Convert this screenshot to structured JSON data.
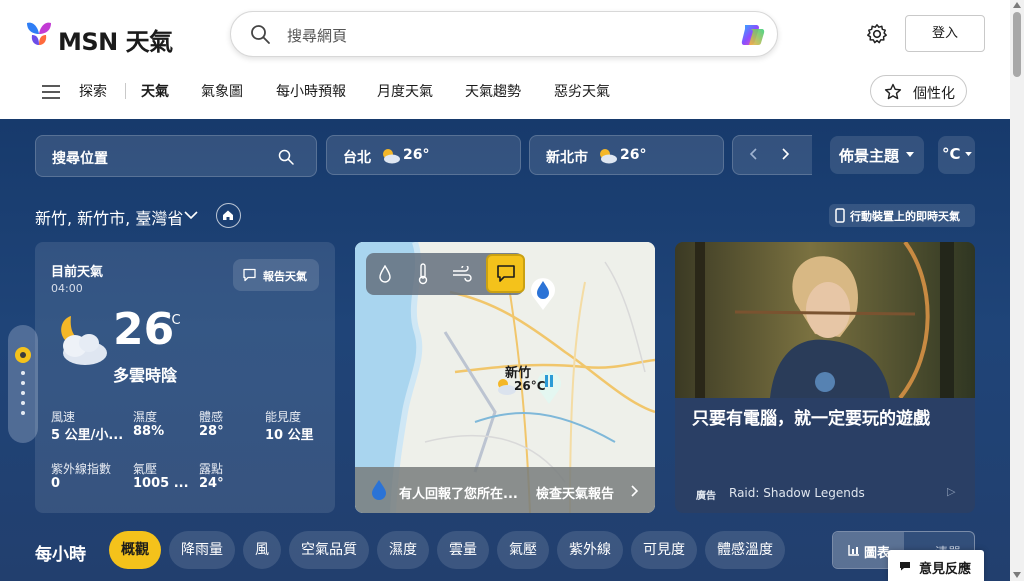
{
  "header": {
    "logo_text": "MSN 天氣",
    "search_placeholder": "搜尋網頁",
    "signin_label": "登入"
  },
  "nav": {
    "items": [
      {
        "label": "探索"
      },
      {
        "label": "天氣",
        "active": true
      },
      {
        "label": "氣象圖"
      },
      {
        "label": "每小時預報"
      },
      {
        "label": "月度天氣"
      },
      {
        "label": "天氣趨勢"
      },
      {
        "label": "惡劣天氣"
      }
    ],
    "personalize_label": "個性化"
  },
  "weather_bar": {
    "location_search_placeholder": "搜尋位置",
    "cities": [
      {
        "name": "台北",
        "temp": "26°"
      },
      {
        "name": "新北市",
        "temp": "26°"
      }
    ],
    "theme_label": "佈景主題",
    "unit_label": "°C"
  },
  "location": {
    "name": "新竹, 新竹市, 臺灣省",
    "mobile_label": "行動裝置上的即時天氣"
  },
  "current": {
    "title": "目前天氣",
    "time": "04:00",
    "report_label": "報告天氣",
    "temp": "26",
    "unit": "°C",
    "condition": "多雲時陰",
    "stats": [
      {
        "label": "風速",
        "value": "5 公里/小..."
      },
      {
        "label": "濕度",
        "value": "88%"
      },
      {
        "label": "體感",
        "value": "28°"
      },
      {
        "label": "能見度",
        "value": "10 公里"
      },
      {
        "label": "紫外線指數",
        "value": "0"
      },
      {
        "label": "氣壓",
        "value": "1005 ..."
      },
      {
        "label": "露點",
        "value": "24°"
      }
    ]
  },
  "map": {
    "city_label": "新竹",
    "city_temp": "26°C",
    "report_text": "有人回報了您所在...",
    "report_link": "檢查天氣報告"
  },
  "ad": {
    "headline": "只要有電腦，就一定要玩的遊戲",
    "ad_label": "廣告",
    "sponsor": "Raid: Shadow Legends"
  },
  "hourly": {
    "title": "每小時",
    "tabs": [
      {
        "label": "概觀",
        "selected": true
      },
      {
        "label": "降雨量"
      },
      {
        "label": "風"
      },
      {
        "label": "空氣品質"
      },
      {
        "label": "濕度"
      },
      {
        "label": "雲量"
      },
      {
        "label": "氣壓"
      },
      {
        "label": "紫外線"
      },
      {
        "label": "可見度"
      },
      {
        "label": "體感溫度"
      }
    ],
    "chart_label": "圖表",
    "list_label": "清單"
  },
  "feedback_label": "意見反應",
  "colors": {
    "accent_yellow": "#f4c21b",
    "weather_bg": "#1f4478"
  }
}
